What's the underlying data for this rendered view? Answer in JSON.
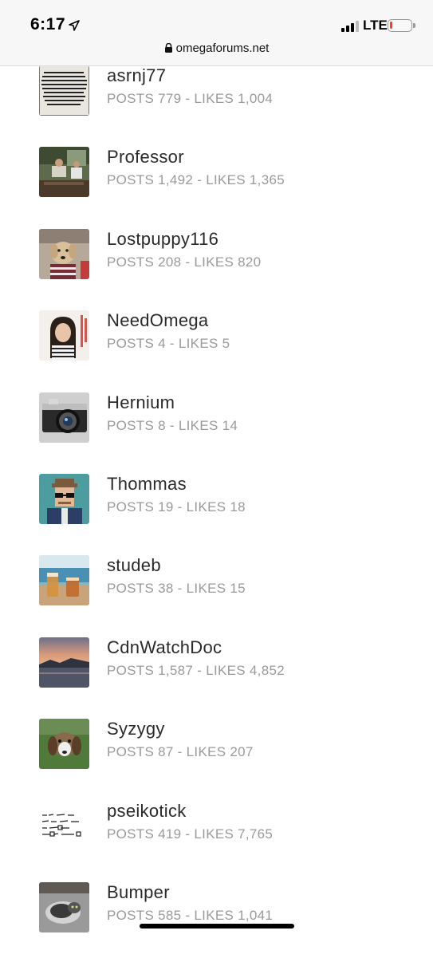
{
  "status_bar": {
    "time": "6:17",
    "network": "LTE",
    "battery_level": 0.1
  },
  "browser": {
    "url": "omegaforums.net"
  },
  "members": [
    {
      "username": "asrnj77",
      "stats": "POSTS 779 - LIKES 1,004",
      "avatar": "pool-sign-avatar"
    },
    {
      "username": "Professor",
      "stats": "POSTS 1,492 - LIKES 1,365",
      "avatar": "outdoor-people-avatar"
    },
    {
      "username": "Lostpuppy116",
      "stats": "POSTS 208 - LIKES 820",
      "avatar": "dog-avatar"
    },
    {
      "username": "NeedOmega",
      "stats": "POSTS 4 - LIKES 5",
      "avatar": "portrait-avatar"
    },
    {
      "username": "Hernium",
      "stats": "POSTS 8 - LIKES 14",
      "avatar": "camera-avatar"
    },
    {
      "username": "Thommas",
      "stats": "POSTS 19 - LIKES 18",
      "avatar": "pixel-art-avatar"
    },
    {
      "username": "studeb",
      "stats": "POSTS 38 - LIKES 15",
      "avatar": "drinks-avatar"
    },
    {
      "username": "CdnWatchDoc",
      "stats": "POSTS 1,587 - LIKES 4,852",
      "avatar": "sunset-lake-avatar"
    },
    {
      "username": "Syzygy",
      "stats": "POSTS 87 - LIKES 207",
      "avatar": "beagle-avatar"
    },
    {
      "username": "pseikotick",
      "stats": "POSTS 419 - LIKES 7,765",
      "avatar": "handwritten-note-avatar"
    },
    {
      "username": "Bumper",
      "stats": "POSTS 585 - LIKES 1,041",
      "avatar": "cat-avatar"
    }
  ],
  "colors": {
    "username": "#2a2a2a",
    "stats": "#9a9a9a",
    "battery_low": "#ff3b30"
  }
}
